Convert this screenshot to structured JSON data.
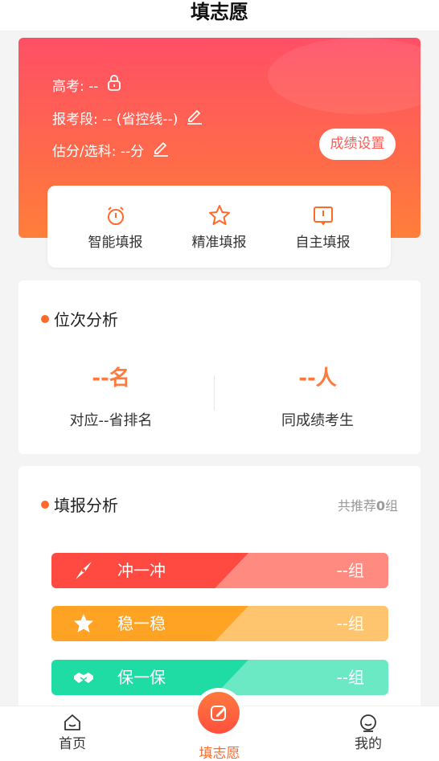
{
  "header": {
    "title": "填志愿"
  },
  "score_panel": {
    "exam_label": "高考: --",
    "level_label": "报考段: -- (省控线--)",
    "estimate_label": "估分/选科: --分",
    "settings_button": "成绩设置",
    "lock_icon": "lock-icon",
    "edit_icon": "edit-icon"
  },
  "modes": [
    {
      "label": "智能填报",
      "icon": "alarm-clock-icon"
    },
    {
      "label": "精准填报",
      "icon": "star-icon"
    },
    {
      "label": "自主填报",
      "icon": "book-icon"
    }
  ],
  "rank_analysis": {
    "title": "位次分析",
    "rank_value": "--名",
    "rank_caption": "对应--省排名",
    "same_value": "--人",
    "same_caption": "同成绩考生"
  },
  "fill_analysis": {
    "title": "填报分析",
    "recommend_prefix": "共推荐",
    "recommend_count": "0",
    "recommend_suffix": "组",
    "bands": [
      {
        "name": "冲一冲",
        "count": "--组",
        "icon": "compass-icon",
        "dark": "#ff4a42",
        "light": "#ff8a80"
      },
      {
        "name": "稳一稳",
        "count": "--组",
        "icon": "star-icon",
        "dark": "#ffa325",
        "light": "#ffc46e"
      },
      {
        "name": "保一保",
        "count": "--组",
        "icon": "handshake-icon",
        "dark": "#1fdca4",
        "light": "#6be9c5"
      }
    ]
  },
  "tabbar": {
    "home": "首页",
    "fill": "填志愿",
    "mine": "我的"
  },
  "colors": {
    "accent": "#ff7b3d",
    "tab_active": "#ff6a2b"
  }
}
